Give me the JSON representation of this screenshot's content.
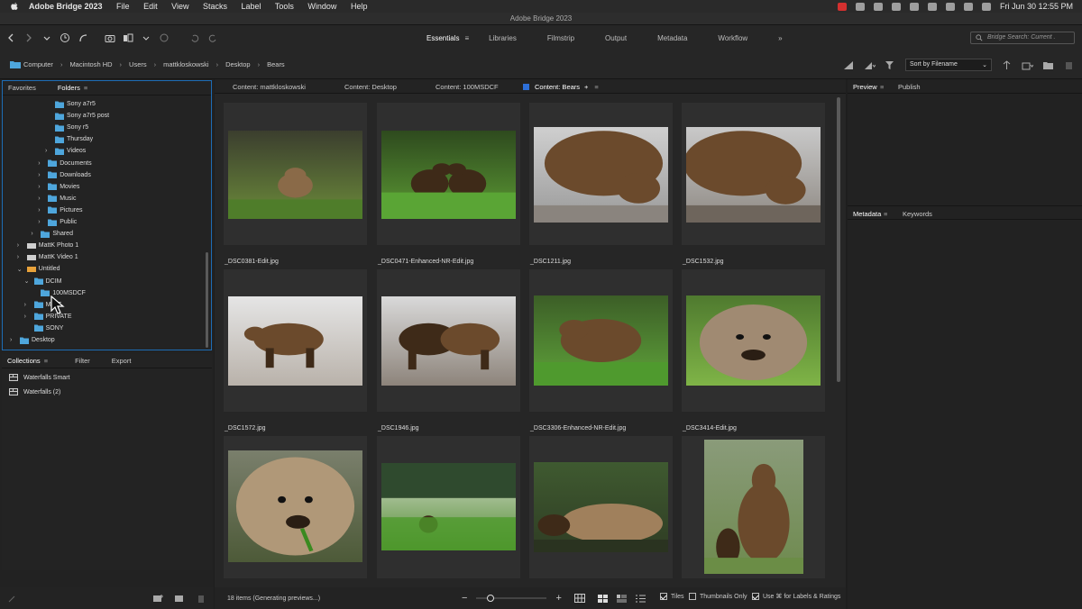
{
  "mac_menu": {
    "app_name": "Adobe Bridge 2023",
    "items": [
      "File",
      "Edit",
      "View",
      "Stacks",
      "Label",
      "Tools",
      "Window",
      "Help"
    ],
    "clock": "Fri Jun 30  12:55 PM"
  },
  "window_title": "Adobe Bridge 2023",
  "workspaces": [
    "Essentials",
    "Libraries",
    "Filmstrip",
    "Output",
    "Metadata",
    "Workflow"
  ],
  "workspace_more": "»",
  "search_placeholder": "Bridge Search: Current .",
  "breadcrumbs": [
    "Computer",
    "Macintosh HD",
    "Users",
    "mattkloskowski",
    "Desktop",
    "Bears"
  ],
  "sort_label": "Sort by Filename",
  "left_tabs": {
    "favorites": "Favorites",
    "folders": "Folders"
  },
  "tree": [
    {
      "label": "Sony a7r5",
      "level": 5,
      "arrow": ""
    },
    {
      "label": "Sony a7r5 post",
      "level": 5,
      "arrow": ""
    },
    {
      "label": "Sony r5",
      "level": 5,
      "arrow": ""
    },
    {
      "label": "Thursday",
      "level": 5,
      "arrow": ""
    },
    {
      "label": "Videos",
      "level": 5,
      "arrow": ">"
    },
    {
      "label": "Documents",
      "level": 4,
      "arrow": ">"
    },
    {
      "label": "Downloads",
      "level": 4,
      "arrow": ">"
    },
    {
      "label": "Movies",
      "level": 4,
      "arrow": ">"
    },
    {
      "label": "Music",
      "level": 4,
      "arrow": ">"
    },
    {
      "label": "Pictures",
      "level": 4,
      "arrow": ">"
    },
    {
      "label": "Public",
      "level": 4,
      "arrow": ">"
    },
    {
      "label": "Shared",
      "level": 3,
      "arrow": ">"
    },
    {
      "label": "MattK Photo 1",
      "level": 1,
      "arrow": ">",
      "drive": true
    },
    {
      "label": "MattK Video 1",
      "level": 1,
      "arrow": ">",
      "drive": true
    },
    {
      "label": "Untitled",
      "level": 1,
      "arrow": "v",
      "drive": true,
      "orange": true
    },
    {
      "label": "DCIM",
      "level": 2,
      "arrow": "v"
    },
    {
      "label": "100MSDCF",
      "level": 3,
      "arrow": ""
    },
    {
      "label": "M      OT",
      "level": 2,
      "arrow": ">"
    },
    {
      "label": "PRIVATE",
      "level": 2,
      "arrow": ">"
    },
    {
      "label": "SONY",
      "level": 2,
      "arrow": ""
    },
    {
      "label": "Desktop",
      "level": 0,
      "arrow": ">"
    }
  ],
  "collections_tabs": {
    "collections": "Collections",
    "filter": "Filter",
    "export": "Export"
  },
  "collections": [
    "Waterfalls Smart",
    "Waterfalls (2)"
  ],
  "content_tabs": [
    "Content: mattkloskowski",
    "Content: Desktop",
    "Content: 100MSDCF",
    "Content: Bears"
  ],
  "content_tab_plus": "+",
  "thumbnails": [
    {
      "name": "_DSC0381-Edit.jpg"
    },
    {
      "name": "_DSC0471-Enhanced-NR-Edit.jpg"
    },
    {
      "name": "_DSC1211.jpg"
    },
    {
      "name": "_DSC1532.jpg"
    },
    {
      "name": "_DSC1572.jpg"
    },
    {
      "name": "_DSC1946.jpg"
    },
    {
      "name": "_DSC3306-Enhanced-NR-Edit.jpg"
    },
    {
      "name": "_DSC3414-Edit.jpg"
    },
    {
      "name": ""
    },
    {
      "name": ""
    },
    {
      "name": ""
    },
    {
      "name": ""
    }
  ],
  "status": "18 items (Generating previews...)",
  "footer_options": {
    "tiles": "Tiles",
    "thumbs_only": "Thumbnails Only",
    "labels": "Use ⌘ for Labels & Ratings"
  },
  "right_tabs": {
    "preview": "Preview",
    "publish": "Publish"
  },
  "right_meta_tabs": {
    "metadata": "Metadata",
    "keywords": "Keywords"
  },
  "colors": {
    "accent": "#1d6db5",
    "folder": "#4ea6dc",
    "drive_orange": "#e8a23a"
  }
}
